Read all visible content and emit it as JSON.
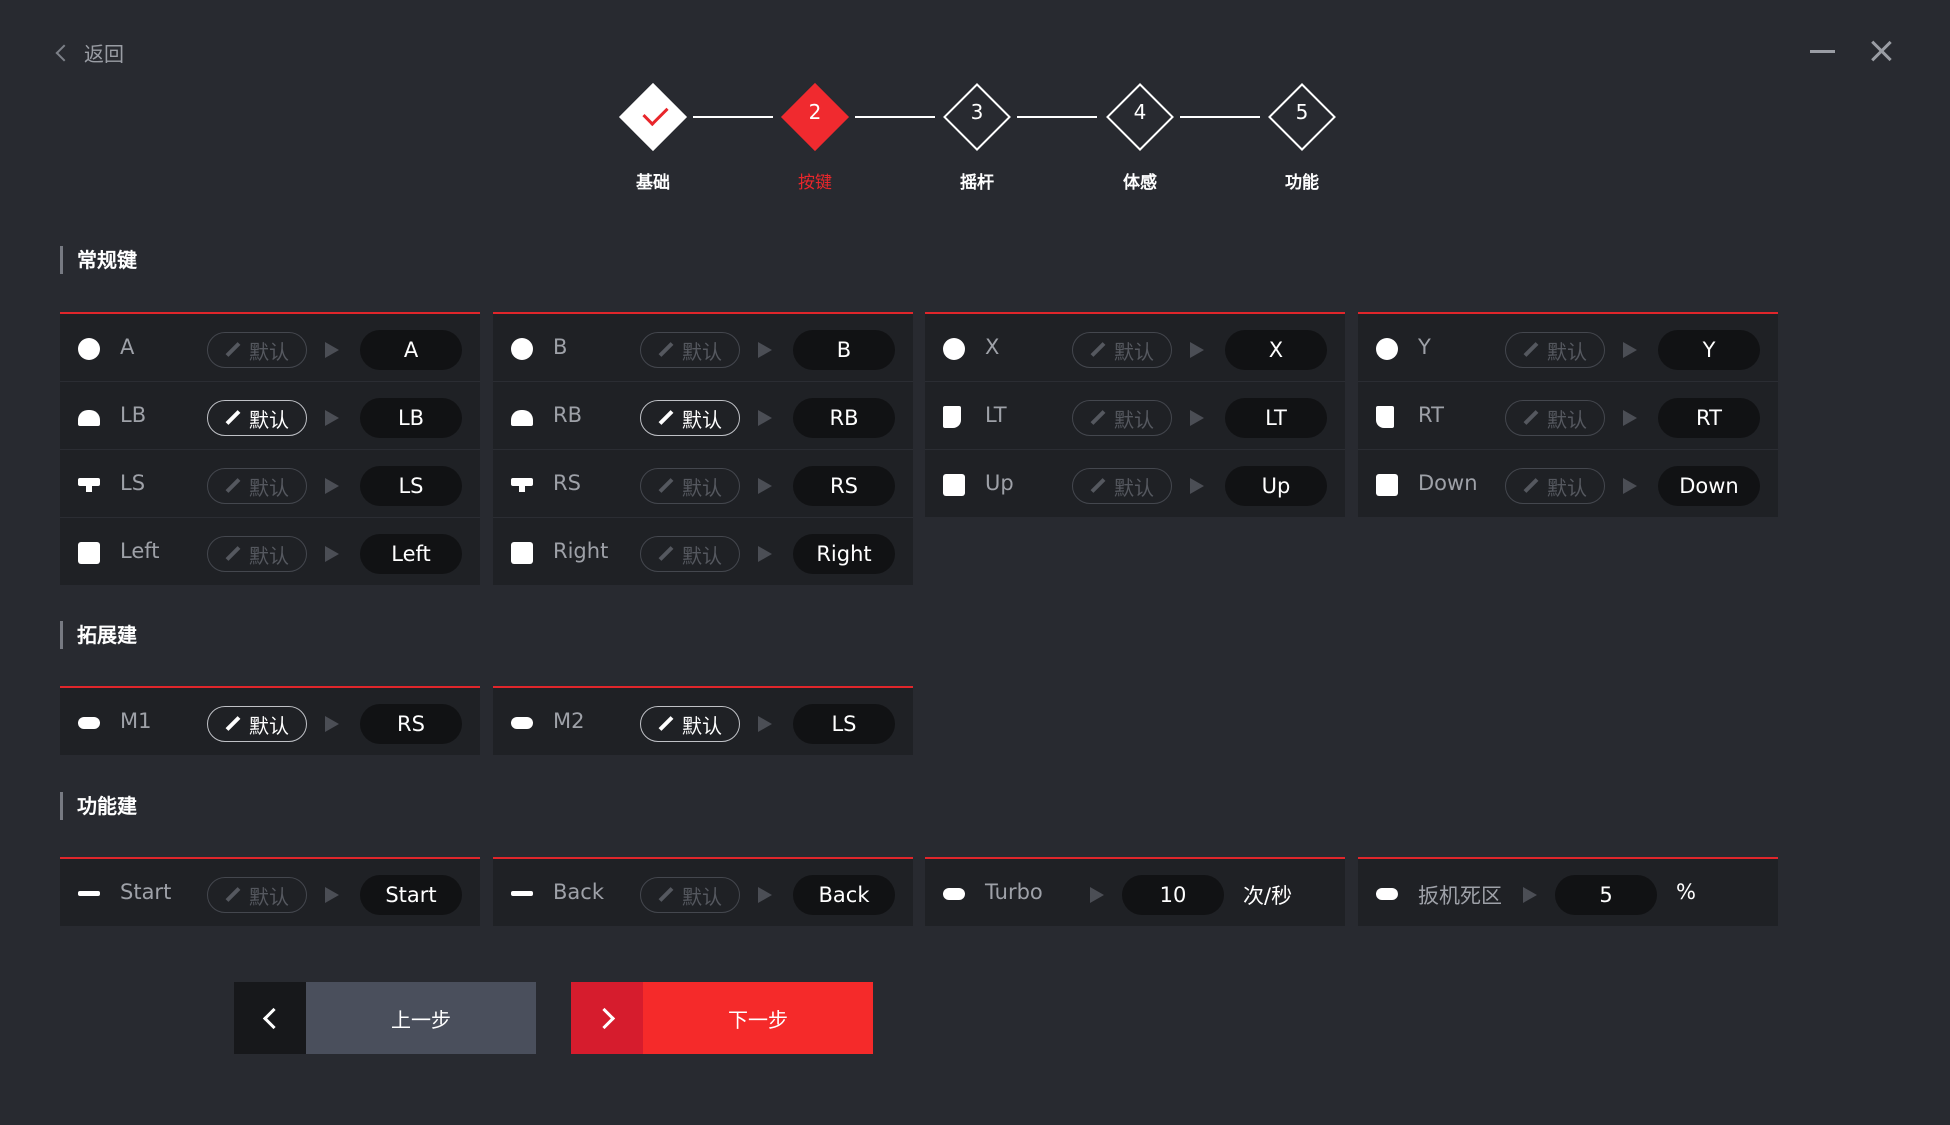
{
  "header": {
    "back_label": "返回"
  },
  "stepper": [
    {
      "num": "",
      "label": "基础",
      "state": "done"
    },
    {
      "num": "2",
      "label": "按键",
      "state": "active"
    },
    {
      "num": "3",
      "label": "摇杆",
      "state": "todo"
    },
    {
      "num": "4",
      "label": "体感",
      "state": "todo"
    },
    {
      "num": "5",
      "label": "功能",
      "state": "todo"
    }
  ],
  "sections": {
    "regular": "常规键",
    "extended": "拓展建",
    "function": "功能建"
  },
  "default_label": "默认",
  "regular_panels": [
    [
      {
        "icon": "circle",
        "name": "A",
        "default_on": false,
        "value": "A"
      },
      {
        "icon": "bumper",
        "name": "LB",
        "default_on": true,
        "value": "LB"
      },
      {
        "icon": "stick",
        "name": "LS",
        "default_on": false,
        "value": "LS"
      },
      {
        "icon": "square",
        "name": "Left",
        "default_on": false,
        "value": "Left"
      }
    ],
    [
      {
        "icon": "circle",
        "name": "B",
        "default_on": false,
        "value": "B"
      },
      {
        "icon": "bumper",
        "name": "RB",
        "default_on": true,
        "value": "RB"
      },
      {
        "icon": "stick",
        "name": "RS",
        "default_on": false,
        "value": "RS"
      },
      {
        "icon": "square",
        "name": "Right",
        "default_on": false,
        "value": "Right"
      }
    ],
    [
      {
        "icon": "circle",
        "name": "X",
        "default_on": false,
        "value": "X"
      },
      {
        "icon": "trigger",
        "name": "LT",
        "default_on": false,
        "value": "LT"
      },
      {
        "icon": "square",
        "name": "Up",
        "default_on": false,
        "value": "Up"
      }
    ],
    [
      {
        "icon": "circle",
        "name": "Y",
        "default_on": false,
        "value": "Y"
      },
      {
        "icon": "trigger-r",
        "name": "RT",
        "default_on": false,
        "value": "RT"
      },
      {
        "icon": "square",
        "name": "Down",
        "default_on": false,
        "value": "Down"
      }
    ]
  ],
  "extended_panels": [
    {
      "icon": "pill",
      "name": "M1",
      "default_on": true,
      "value": "RS"
    },
    {
      "icon": "pill",
      "name": "M2",
      "default_on": true,
      "value": "LS"
    }
  ],
  "function_panels": [
    {
      "icon": "dash",
      "name": "Start",
      "default_on": false,
      "value": "Start",
      "type": "map"
    },
    {
      "icon": "dash",
      "name": "Back",
      "default_on": false,
      "value": "Back",
      "type": "map"
    },
    {
      "icon": "pill",
      "name": "Turbo",
      "value": "10",
      "unit": "次/秒",
      "type": "setting"
    },
    {
      "icon": "pill",
      "name": "扳机死区",
      "value": "5",
      "unit": "%",
      "type": "setting"
    }
  ],
  "nav": {
    "prev_label": "上一步",
    "next_label": "下一步"
  },
  "colors": {
    "accent": "#e8262b",
    "background": "#282a30",
    "panel": "#1f2125"
  }
}
